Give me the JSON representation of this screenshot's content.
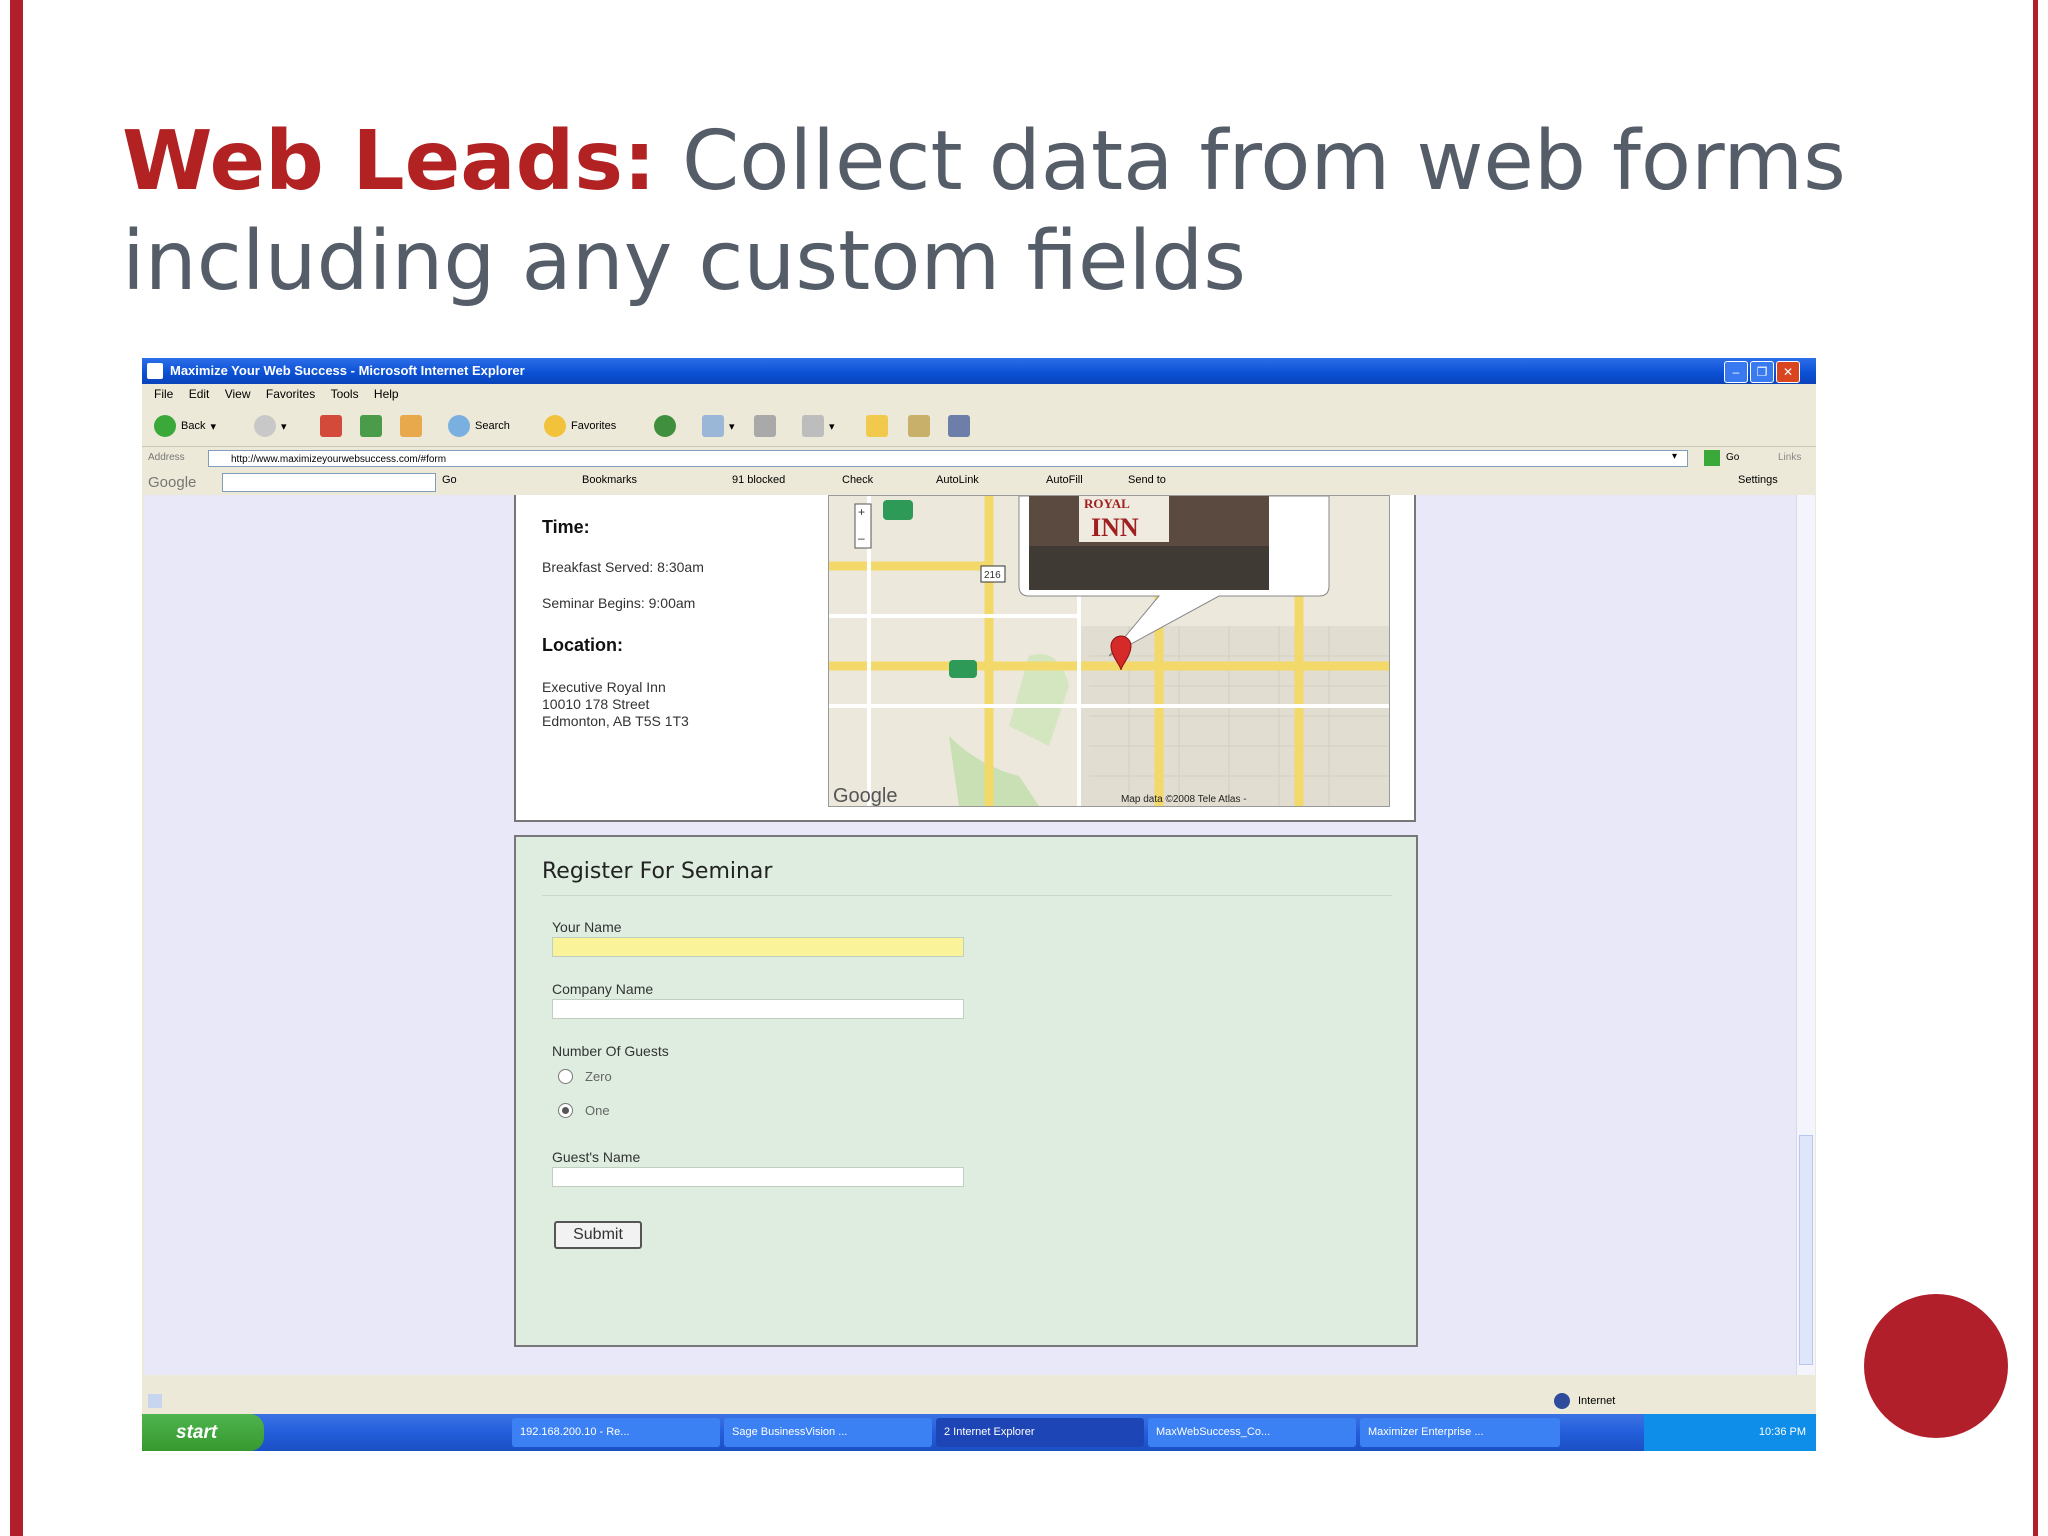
{
  "slide": {
    "title_highlight": "Web Leads:",
    "title_rest": " Collect data from web forms including any custom fields",
    "colors": {
      "accent": "#b22222",
      "frame": "#b11f2b",
      "title_gray": "#555d69"
    }
  },
  "browser": {
    "window_title": "Maximize Your Web Success - Microsoft Internet Explorer",
    "menu": [
      "File",
      "Edit",
      "View",
      "Favorites",
      "Tools",
      "Help"
    ],
    "toolbar": {
      "back": "Back",
      "search": "Search",
      "favorites": "Favorites"
    },
    "address_label": "Address",
    "address_url": "http://www.maximizeyourwebsuccess.com/#form",
    "go": "Go",
    "links": "Links",
    "google_bar": {
      "logo": "Google",
      "go": "Go",
      "bookmarks": "Bookmarks",
      "blocked": "91 blocked",
      "check": "Check",
      "autolink": "AutoLink",
      "autofill": "AutoFill",
      "send_to": "Send to",
      "settings": "Settings"
    },
    "status_zone": "Internet"
  },
  "info": {
    "time_heading": "Time:",
    "breakfast": "Breakfast Served: 8:30am",
    "seminar": "Seminar Begins: 9:00am",
    "location_heading": "Location:",
    "address_line1": "Executive Royal Inn",
    "address_line2": "10010 178 Street",
    "address_line3": "Edmonton, AB T5S 1T3"
  },
  "map": {
    "sign_top": "ROYAL",
    "sign_main": "INN",
    "highway": "216",
    "credit": "Map data ©2008 Tele Atlas -",
    "logo": "Google"
  },
  "form": {
    "title": "Register For Seminar",
    "your_name_label": "Your Name",
    "company_label": "Company Name",
    "guests_label": "Number Of Guests",
    "option_zero": "Zero",
    "option_one": "One",
    "guest_name_label": "Guest's Name",
    "submit": "Submit"
  },
  "taskbar": {
    "start": "start",
    "tasks": [
      "192.168.200.10 - Re...",
      "Sage BusinessVision ...",
      "2 Internet Explorer",
      "MaxWebSuccess_Co...",
      "Maximizer Enterprise ..."
    ],
    "clock": "10:36 PM"
  }
}
